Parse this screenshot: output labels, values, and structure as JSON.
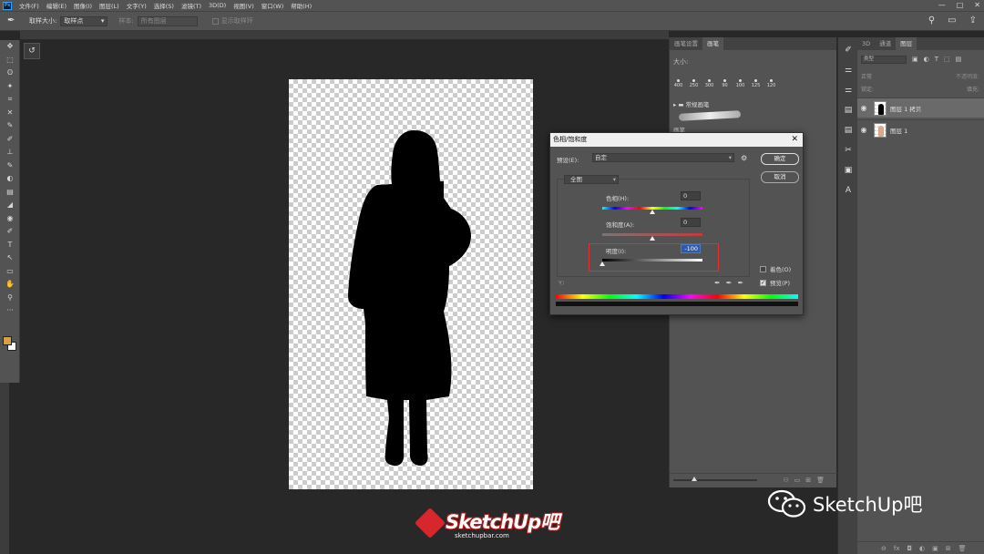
{
  "menubar": {
    "logo": "Ps",
    "items": [
      "文件(F)",
      "编辑(E)",
      "图像(I)",
      "图层(L)",
      "文字(Y)",
      "选择(S)",
      "滤镜(T)",
      "3D(D)",
      "视图(V)",
      "窗口(W)",
      "帮助(H)"
    ],
    "window_controls": [
      "—",
      "□",
      "✕"
    ]
  },
  "options_bar": {
    "sample_size_label": "取样大小:",
    "sample_size_value": "取样点",
    "sample_label": "样本:",
    "sample_value": "所有图层",
    "show_ring_label": "显示取样环"
  },
  "toolbox": {
    "tools": [
      "✥",
      "⬚",
      "ʘ",
      "✦",
      "⌗",
      "✕",
      "✎",
      "✐",
      "⊥",
      "✎",
      "◐",
      "▤",
      "◢",
      "◉",
      "✐",
      "T",
      "↖",
      "▭",
      "✋",
      "⚲",
      "···"
    ],
    "foreground_color": "#d4a04a",
    "background_color": "#ffffff"
  },
  "mid_panel": {
    "tabs": [
      "画笔设置",
      "画笔"
    ],
    "size_label": "大小:",
    "presets": [
      "400",
      "250",
      "300",
      "90",
      "100",
      "125",
      "120"
    ],
    "folder": "常规画笔",
    "brush_label": "画笔"
  },
  "layers_panel": {
    "tabs": [
      "3D",
      "通道",
      "图层"
    ],
    "filter": "类型",
    "blend_mode": "正常",
    "opacity_label": "不透明度:",
    "lock_label": "锁定:",
    "fill_label": "填充:",
    "layers": [
      {
        "name": "图层 1 拷贝",
        "selected": true
      },
      {
        "name": "图层 1",
        "selected": false
      }
    ],
    "bottom_icons": [
      "⊖",
      "fx",
      "◘",
      "◐",
      "▣",
      "⊞",
      "🗑"
    ]
  },
  "dialog": {
    "title": "色相/饱和度",
    "preset_label": "预设(E):",
    "preset_value": "自定",
    "ok_label": "确定",
    "cancel_label": "取消",
    "channel": "全图",
    "hue_label": "色相(H):",
    "hue_value": "0",
    "saturation_label": "饱和度(A):",
    "saturation_value": "0",
    "lightness_label": "明度(I):",
    "lightness_value": "-100",
    "colorize_label": "着色(O)",
    "colorize_checked": false,
    "preview_label": "预览(P)",
    "preview_checked": true
  },
  "watermark": {
    "logo_text": "SketchUp吧",
    "logo_url": "sketchupbar.com",
    "wechat_text": "SketchUp吧"
  }
}
